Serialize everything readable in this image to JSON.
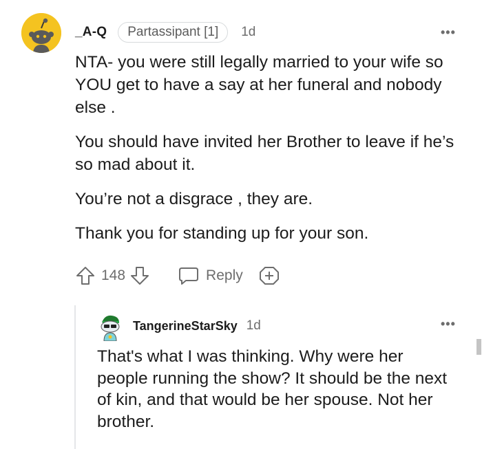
{
  "comment": {
    "username": "_A-Q",
    "flair": "Partassipant [1]",
    "time": "1d",
    "more_label": "•••",
    "paragraphs": [
      "NTA- you were still legally married to your wife so YOU get to have a say at her funeral and nobody else .",
      "You should have invited her Brother to leave if he’s so mad about it.",
      "You’re not a disgrace , they are.",
      "Thank you for standing up for your son."
    ],
    "votes": "148",
    "reply_label": "Reply",
    "avatar_color": "#f4c320"
  },
  "reply": {
    "username": "TangerineStarSky",
    "time": "1d",
    "more_label": "•••",
    "text": "That's what I was thinking. Why were her people running the show? It should be the next of kin, and that would be her spouse. Not her brother."
  },
  "icons": {
    "upvote": "upvote-arrow-icon",
    "downvote": "downvote-arrow-icon",
    "reply": "speech-bubble-icon",
    "award": "award-plus-icon"
  }
}
